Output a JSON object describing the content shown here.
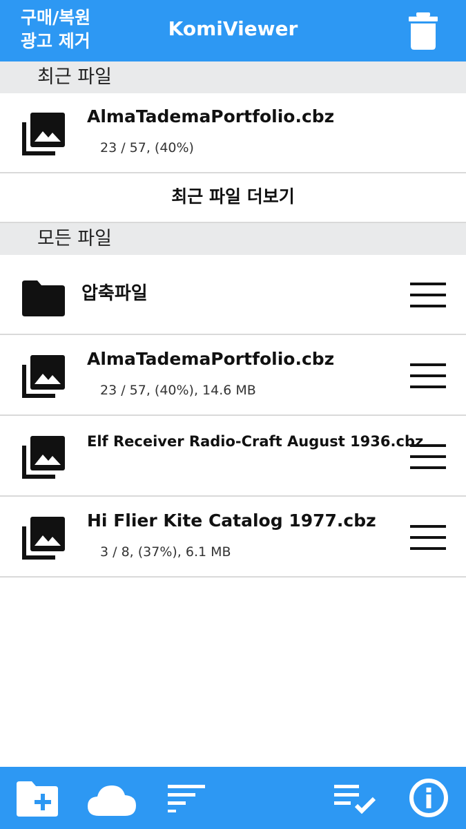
{
  "header": {
    "purchase_line1": "구매/복원",
    "purchase_line2": "광고 제거",
    "title": "KomiViewer",
    "trash_icon": "trash-icon"
  },
  "recent": {
    "section_label": "최근 파일",
    "items": [
      {
        "name": "AlmaTademaPortfolio.cbz",
        "meta": "23 / 57, (40%)",
        "icon": "image-stack-icon"
      }
    ],
    "more_label": "최근 파일 더보기"
  },
  "all": {
    "section_label": "모든 파일",
    "folder": {
      "name": "압축파일",
      "icon": "folder-icon"
    },
    "items": [
      {
        "name": "AlmaTademaPortfolio.cbz",
        "meta": "23 / 57, (40%), 14.6 MB",
        "icon": "image-stack-icon"
      },
      {
        "name": "Elf Receiver Radio-Craft August 1936.cbz",
        "meta": "",
        "icon": "image-stack-icon"
      },
      {
        "name": "Hi Flier Kite Catalog 1977.cbz",
        "meta": "3 / 8, (37%), 6.1 MB",
        "icon": "image-stack-icon"
      }
    ]
  },
  "bottom_bar": {
    "icons": [
      "new-folder-icon",
      "cloud-icon",
      "sort-icon",
      "select-list-icon",
      "info-icon"
    ]
  },
  "colors": {
    "accent": "#2d98f3",
    "section_bg": "#e9eaeb",
    "divider": "#d9d9d9"
  }
}
